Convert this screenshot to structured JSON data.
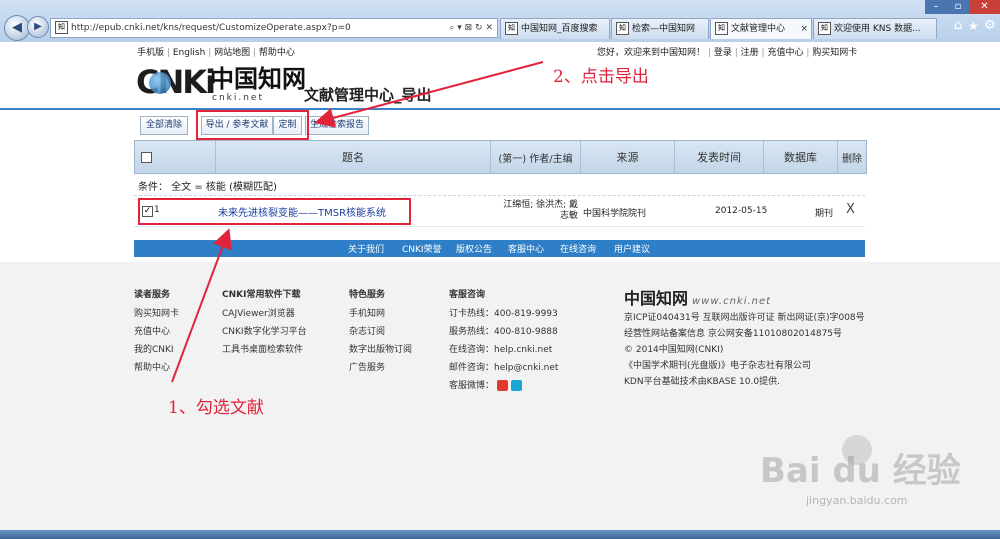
{
  "browser": {
    "address": "http://epub.cnki.net/kns/request/CustomizeOperate.aspx?p=0",
    "tabs": [
      {
        "label": "中国知网_百度搜索"
      },
      {
        "label": "检索—中国知网"
      },
      {
        "label": "文献管理中心",
        "close": "×"
      },
      {
        "label": "欢迎使用 KNS 数据..."
      }
    ]
  },
  "topbar": {
    "left_links": [
      "手机版",
      "English",
      "网站地图",
      "帮助中心"
    ],
    "welcome": "您好，欢迎来到中国知网！",
    "right_links": [
      "登录",
      "注册",
      "充值中心",
      "购买知网卡"
    ]
  },
  "header": {
    "logo_text": "CNKi",
    "logo_cn": "中国知网",
    "logo_url": "cnki.net",
    "title": "文献管理中心_导出"
  },
  "toolbar": {
    "clear_all": "全部清除",
    "export": "导出 / 参考文献",
    "customize": "定制",
    "report": "生成检索报告"
  },
  "table": {
    "headers": {
      "title": "题名",
      "author": "(第一) 作者/主编",
      "source": "来源",
      "date": "发表时间",
      "db": "数据库",
      "delete": "删除"
    },
    "condition": "条件：  全文 = 核能 (模糊匹配)",
    "rows": [
      {
        "index": "1",
        "title": "未来先进核裂变能——TMSR核能系统",
        "author": "江绵恒; 徐洪杰; 戴志敏",
        "source": "中国科学院院刊",
        "date": "2012-05-15",
        "db": "期刊",
        "delete": "X"
      }
    ]
  },
  "footer_nav": [
    "关于我们",
    "CNKI荣誉",
    "版权公告",
    "客服中心",
    "在线咨询",
    "用户建议"
  ],
  "footer": {
    "columns": [
      {
        "title": "读者服务",
        "items": [
          "购买知网卡",
          "充值中心",
          "我的CNKI",
          "帮助中心"
        ]
      },
      {
        "title": "CNKI常用软件下载",
        "items": [
          "CAJViewer浏览器",
          "CNKI数字化学习平台",
          "工具书桌面检索软件"
        ]
      },
      {
        "title": "特色服务",
        "items": [
          "手机知网",
          "杂志订阅",
          "数字出版物订阅",
          "广告服务"
        ]
      },
      {
        "title": "客服咨询",
        "items": [
          "订卡热线：400-819-9993",
          "服务热线：400-810-9888",
          "在线咨询：help.cnki.net",
          "邮件咨询：help@cnki.net",
          "客服微博："
        ]
      }
    ],
    "brand_cn": "中国知网",
    "brand_url": "www.cnki.net",
    "info": [
      "京ICP证040431号 互联网出版许可证 新出网证(京)字008号",
      "经营性网站备案信息 京公网安备11010802014875号",
      "© 2014中国知网(CNKI)",
      "《中国学术期刊(光盘版)》电子杂志社有限公司",
      "KDN平台基础技术由KBASE 10.0提供."
    ]
  },
  "annotations": {
    "step1": "1、勾选文献",
    "step2": "2、点击导出"
  },
  "watermark": {
    "text": "Bai du 经验",
    "url": "jingyan.baidu.com"
  },
  "colors": {
    "annotation_red": "#e2233a",
    "footer_nav_blue": "#2e7fc7",
    "link_blue": "#1a3d73"
  }
}
